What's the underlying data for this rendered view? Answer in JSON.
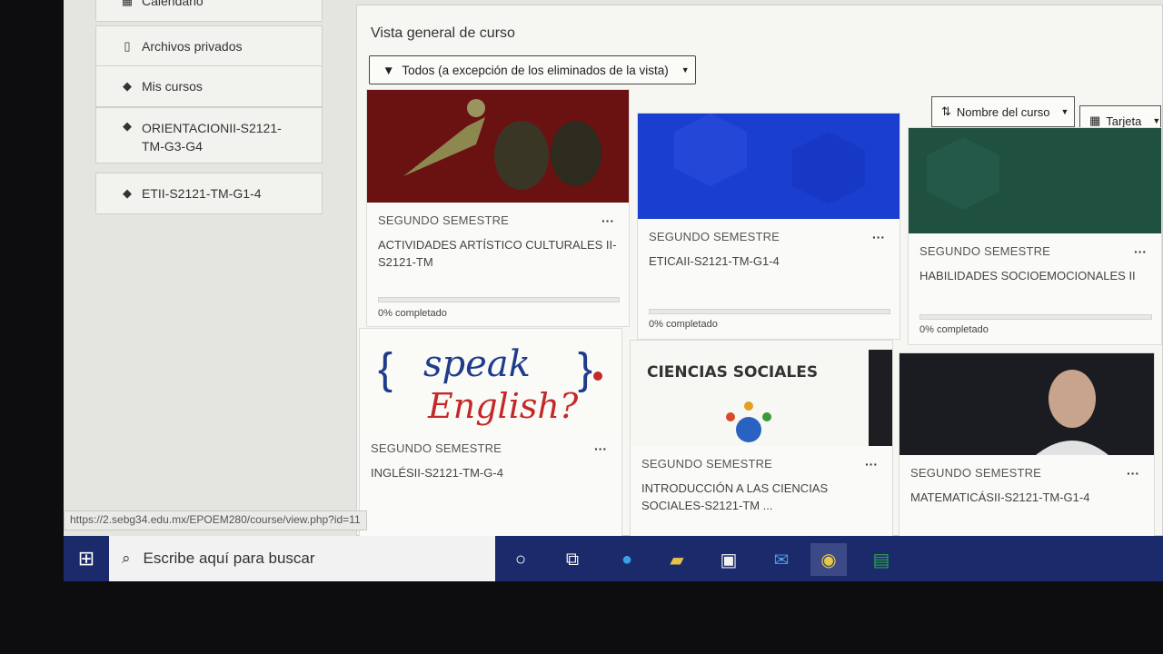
{
  "nav": {
    "items": [
      {
        "icon": "calendar-icon",
        "label": "Calendario"
      },
      {
        "icon": "file-icon",
        "label": "Archivos privados"
      },
      {
        "icon": "graduation-cap-icon",
        "label": "Mis cursos"
      },
      {
        "icon": "graduation-cap-icon",
        "label": "ORIENTACIONII-S2121-TM-G3-G4"
      },
      {
        "icon": "graduation-cap-icon",
        "label": "ETII-S2121-TM-G1-4"
      }
    ]
  },
  "overview": {
    "title": "Vista general de curso",
    "filter_label": "Todos (a excepción de los eliminados de la vista)",
    "sort_label": "Nombre del curso",
    "view_label": "Tarjeta"
  },
  "courses": [
    {
      "semester": "SEGUNDO SEMESTRE",
      "name": "ACTIVIDADES ARTÍSTICO CULTURALES II-S2121-TM",
      "progress_text": "0% completado",
      "progress": 0,
      "image": "theatre-masks"
    },
    {
      "semester": "SEGUNDO SEMESTRE",
      "name": "ETICAII-S2121-TM-G1-4",
      "progress_text": "0% completado",
      "progress": 0,
      "image": "blue-pattern"
    },
    {
      "semester": "SEGUNDO SEMESTRE",
      "name": "HABILIDADES SOCIOEMOCIONALES II",
      "progress_text": "0% completado",
      "progress": 0,
      "image": "green-pattern"
    },
    {
      "semester": "SEGUNDO SEMESTRE",
      "name": "INGLÉSII-S2121-TM-G-4",
      "image": "speak-english",
      "image_text_1": "speak",
      "image_text_2": "English?"
    },
    {
      "semester": "SEGUNDO SEMESTRE",
      "name": "INTRODUCCIÓN A LAS CIENCIAS SOCIALES-S2121-TM ...",
      "image": "ciencias-sociales",
      "image_text": "CIENCIAS SOCIALES"
    },
    {
      "semester": "SEGUNDO SEMESTRE",
      "name": "MATEMATICÁSII-S2121-TM-G1-4",
      "image": "portrait"
    }
  ],
  "status_url": "https://2.sebg34.edu.mx/EPOEM280/course/view.php?id=11",
  "taskbar": {
    "search_placeholder": "Escribe aquí para buscar",
    "apps": [
      "cortana-icon",
      "task-view-icon",
      "edge-icon",
      "file-explorer-icon",
      "store-icon",
      "mail-icon",
      "chrome-icon",
      "excel-icon"
    ]
  },
  "colors": {
    "taskbar": "#1b2a6a",
    "card_blue": "#1a3fd0",
    "card_green": "#1f5040",
    "card_red": "#6e1414"
  }
}
